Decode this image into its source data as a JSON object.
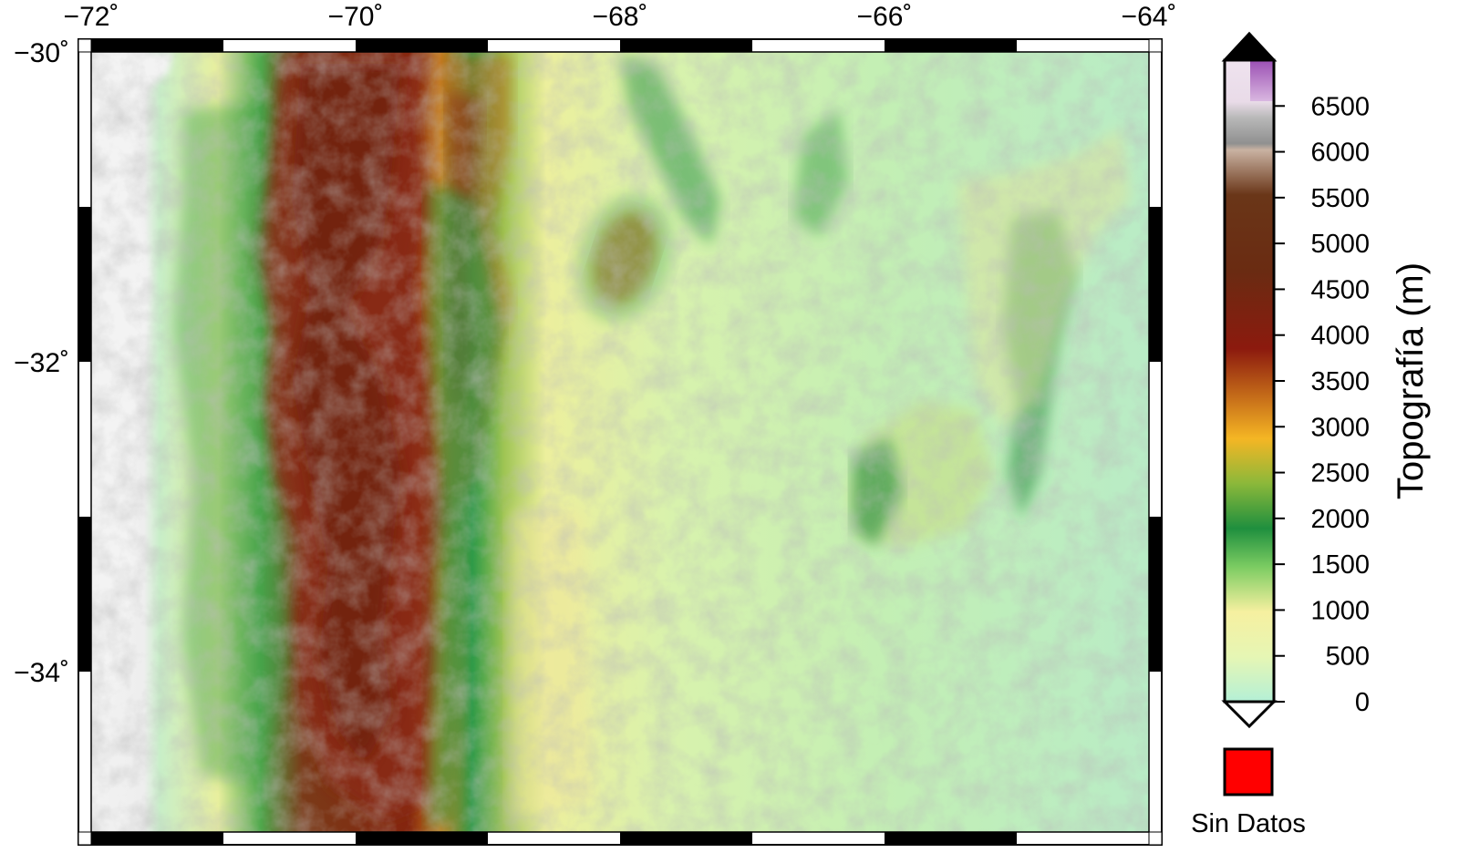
{
  "map": {
    "lon_ticks": [
      "−72˚",
      "−70˚",
      "−68˚",
      "−66˚",
      "−64˚"
    ],
    "lat_ticks": [
      "−30˚",
      "−32˚",
      "−34˚"
    ],
    "region": {
      "lon_min": -72,
      "lon_max": -64,
      "lat_min": -35.1,
      "lat_max": -30
    }
  },
  "colorbar": {
    "title": "Topografía (m)",
    "tick_labels": [
      "0",
      "500",
      "1000",
      "1500",
      "2000",
      "2500",
      "3000",
      "3500",
      "4000",
      "4500",
      "5000",
      "5500",
      "6000",
      "6500"
    ],
    "range": [
      0,
      7000
    ],
    "colors": [
      "#b9f2d5",
      "#ecf5a9",
      "#2d9a46",
      "#f2b22a",
      "#8a1d0c",
      "#5b2a13",
      "#ffffff",
      "#a35bb0"
    ]
  },
  "nodata": {
    "label": "Sin Datos",
    "color": "#ff0000"
  }
}
